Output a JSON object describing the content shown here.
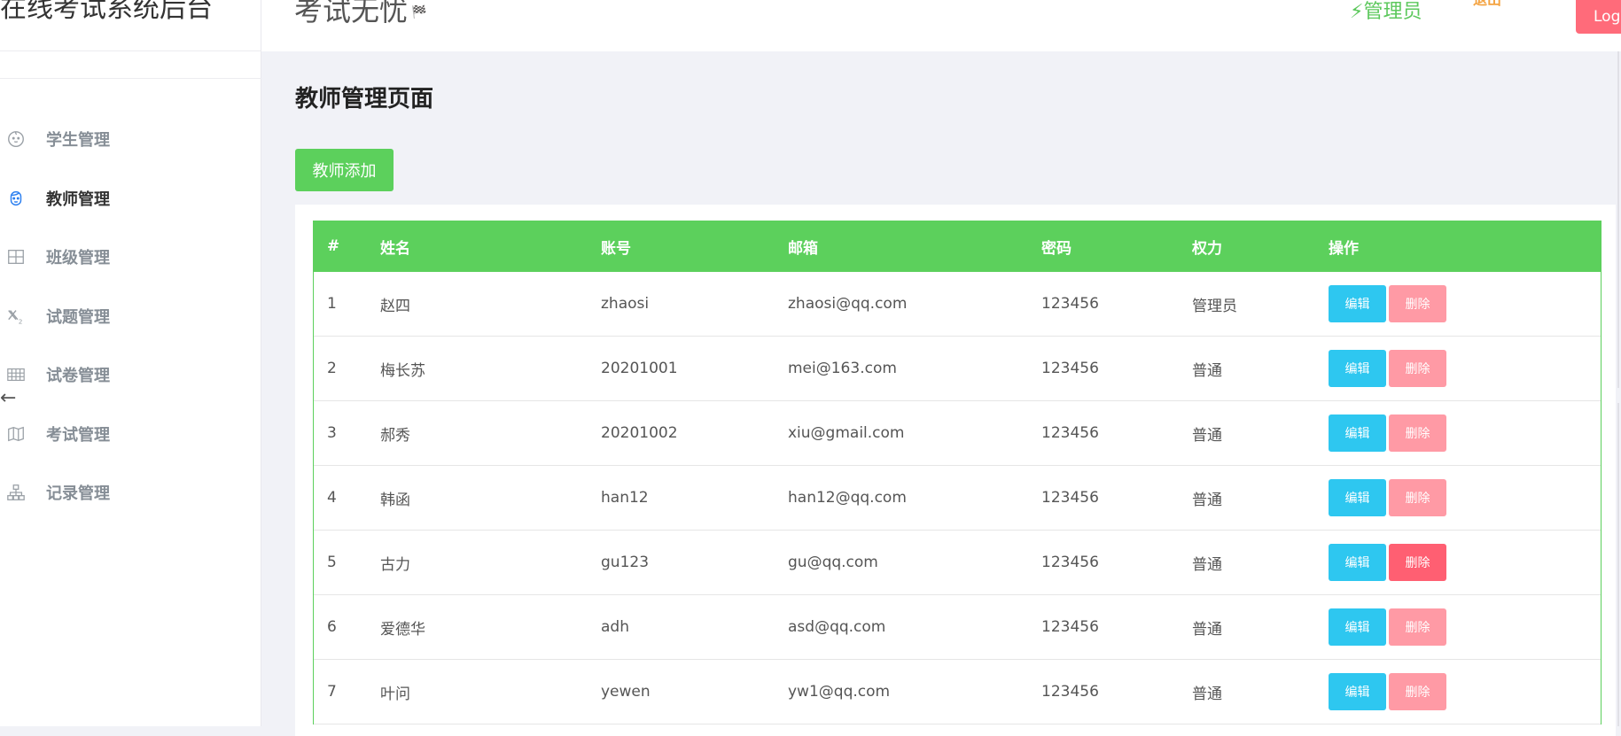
{
  "app": {
    "brand": "在线考试系统后台",
    "header_title": "考试无忧",
    "header_flag": "🏁",
    "role_label": "⚡管理员",
    "orange_text": "退出",
    "logout_label": "Logout"
  },
  "sidebar": {
    "items": [
      {
        "label": "学生管理",
        "icon": "baby-face-icon"
      },
      {
        "label": "教师管理",
        "icon": "teacher-face-icon"
      },
      {
        "label": "班级管理",
        "icon": "grid-icon"
      },
      {
        "label": "试题管理",
        "icon": "subscript-icon"
      },
      {
        "label": "试卷管理",
        "icon": "table-icon"
      },
      {
        "label": "考试管理",
        "icon": "map-icon"
      },
      {
        "label": "记录管理",
        "icon": "sitemap-icon"
      }
    ],
    "active_index": 1,
    "collapse_icon": "←"
  },
  "main": {
    "page_title": "教师管理页面",
    "add_button": "教师添加",
    "table": {
      "headers": [
        "#",
        "姓名",
        "账号",
        "邮箱",
        "密码",
        "权力",
        "操作"
      ],
      "rows": [
        [
          "1",
          "赵四",
          "zhaosi",
          "zhaosi@qq.com",
          "123456",
          "管理员"
        ],
        [
          "2",
          "梅长苏",
          "20201001",
          "mei@163.com",
          "123456",
          "普通"
        ],
        [
          "3",
          "郝秀",
          "20201002",
          "xiu@gmail.com",
          "123456",
          "普通"
        ],
        [
          "4",
          "韩函",
          "han12",
          "han12@qq.com",
          "123456",
          "普通"
        ],
        [
          "5",
          "古力",
          "gu123",
          "gu@qq.com",
          "123456",
          "普通"
        ],
        [
          "6",
          "爱德华",
          "adh",
          "asd@qq.com",
          "123456",
          "普通"
        ],
        [
          "7",
          "叶问",
          "yewen",
          "yw1@qq.com",
          "123456",
          "普通"
        ]
      ],
      "edit_label": "编辑",
      "delete_label": "删除"
    }
  },
  "colors": {
    "primary_green": "#5cd05c",
    "edit_blue": "#2ec7f0",
    "delete_pink": "#ff9aa5",
    "delete_hover": "#ff5f72",
    "logout_red": "#ff6b7a"
  }
}
